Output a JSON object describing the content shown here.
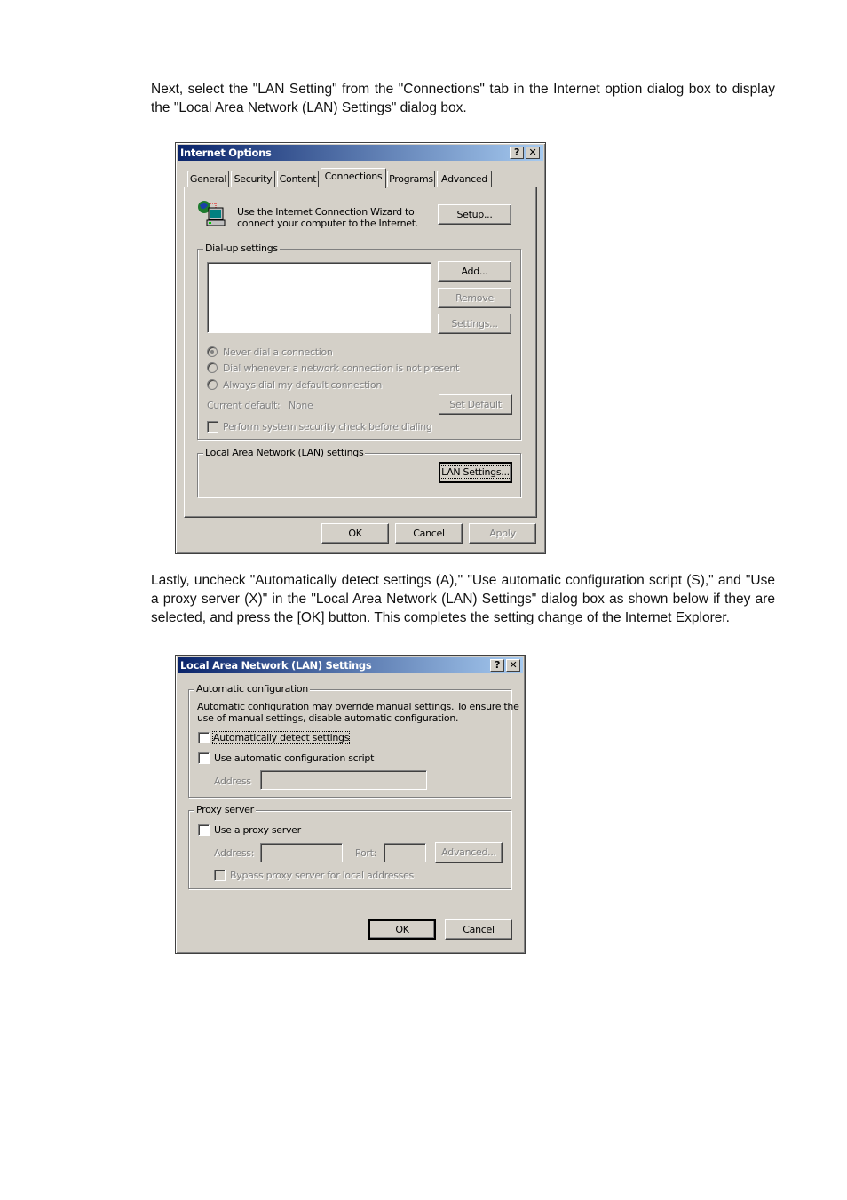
{
  "paragraphs": {
    "intro": "Next, select the \"LAN Setting\" from the \"Connections\" tab in the Internet option dialog box to display the \"Local Area Network (LAN) Settings\" dialog box.",
    "lastly": "Lastly, uncheck \"Automatically detect settings (A),\" \"Use automatic configuration script (S),\" and \"Use a proxy server (X)\" in the \"Local Area Network (LAN) Settings\" dialog box as shown below if they are selected, and press the [OK] button.  This completes the setting change of the Internet Explorer."
  },
  "internet_options": {
    "title": "Internet Options",
    "help_label": "?",
    "close_label": "✕",
    "tabs": [
      {
        "label": "General",
        "selected": false
      },
      {
        "label": "Security",
        "selected": false
      },
      {
        "label": "Content",
        "selected": false
      },
      {
        "label": "Connections",
        "selected": true
      },
      {
        "label": "Programs",
        "selected": false
      },
      {
        "label": "Advanced",
        "selected": false
      }
    ],
    "wizard_icon": "computer-globe-icon",
    "wizard_text_1": "Use the Internet Connection Wizard to",
    "wizard_text_2": "connect your computer to the Internet.",
    "setup_button": "Setup...",
    "dialup_legend": "Dial-up settings",
    "add_button": "Add...",
    "remove_button": "Remove",
    "settings_button": "Settings...",
    "radios": [
      {
        "label": "Never dial a connection",
        "checked": true
      },
      {
        "label": "Dial whenever a network connection is not present",
        "checked": false
      },
      {
        "label": "Always dial my default connection",
        "checked": false
      }
    ],
    "current_default_label": "Current default:",
    "current_default_value": "None",
    "set_default_button": "Set Default",
    "security_check_label": "Perform system security check before dialing",
    "security_check_checked": false,
    "lan_legend": "Local Area Network (LAN) settings",
    "lan_settings_button": "LAN Settings...",
    "ok_button": "OK",
    "cancel_button": "Cancel",
    "apply_button": "Apply"
  },
  "lan_settings": {
    "title": "Local Area Network (LAN) Settings",
    "help_label": "?",
    "close_label": "✕",
    "auto_legend": "Automatic configuration",
    "auto_desc_1": "Automatic configuration may override manual settings.  To ensure the",
    "auto_desc_2": "use of manual settings, disable automatic configuration.",
    "auto_detect_label": "Automatically detect settings",
    "auto_detect_checked": false,
    "auto_script_label": "Use automatic configuration script",
    "auto_script_checked": false,
    "script_address_label": "Address",
    "script_address_value": "",
    "proxy_legend": "Proxy server",
    "use_proxy_label": "Use a proxy server",
    "use_proxy_checked": false,
    "proxy_address_label": "Address:",
    "proxy_address_value": "",
    "port_label": "Port:",
    "port_value": "",
    "advanced_button": "Advanced...",
    "bypass_label": "Bypass proxy server for local addresses",
    "bypass_checked": false,
    "ok_button": "OK",
    "cancel_button": "Cancel"
  },
  "colors": {
    "dialog_face": "#d4d0c8",
    "title_start": "#0a246a",
    "title_end": "#a6caf0",
    "disabled_text": "#808080"
  }
}
